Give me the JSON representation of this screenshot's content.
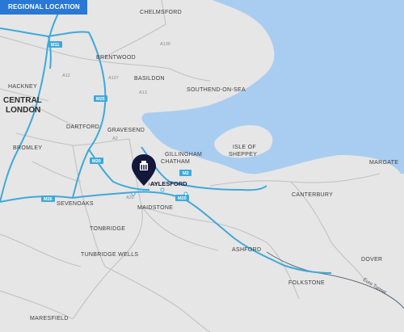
{
  "badge": {
    "label": "REGIONAL LOCATION"
  },
  "colors": {
    "land": "#e6e6e6",
    "sea": "#a9cdf0",
    "motorway": "#3fa9d9",
    "road": "#bfbfbf",
    "badge": "#2a78d6",
    "marker": "#14163a"
  },
  "places": {
    "chelmsford": "CHELMSFORD",
    "brentwood": "BRENTWOOD",
    "basildon": "BASILDON",
    "southend": "SOUTHEND-ON-SEA",
    "hackney": "HACKNEY",
    "central_london": "CENTRAL\nLONDON",
    "dartford": "DARTFORD",
    "gravesend": "GRAVESEND",
    "bromley": "BROMLEY",
    "gillingham": "GILLINGHAM",
    "chatham": "CHATHAM",
    "isle_of_sheppey": "ISLE OF\nSHEPPEY",
    "margate": "MARGATE",
    "aylesford": "AYLESFORD",
    "canterbury": "CANTERBURY",
    "sevenoaks": "SEVENOAKS",
    "maidstone": "MAIDSTONE",
    "tonbridge": "TONBRIDGE",
    "tunbridge_wells": "TUNBRIDGE WELLS",
    "ashford": "ASHFORD",
    "dover": "DOVER",
    "folkstone": "FOLKSTONE",
    "maresfield": "MARESFIELD"
  },
  "roads": {
    "m11": "M11",
    "m25": "M25",
    "m20": "M20",
    "m2": "M2",
    "m26": "M26",
    "a130": "A130",
    "a127": "A127",
    "a13": "A13",
    "a12": "A12",
    "a2": "A2",
    "a228": "A228",
    "a20": "A20"
  },
  "tunnel": "Euro Tunnel",
  "marker": {
    "icon": "building-icon"
  }
}
